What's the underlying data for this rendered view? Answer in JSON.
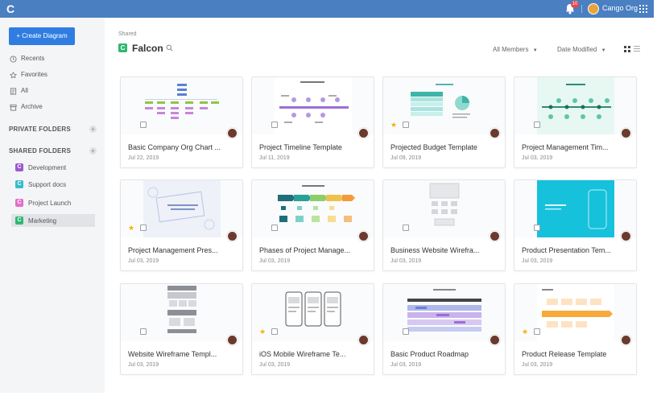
{
  "topbar": {
    "logo": "C",
    "notifications": "10",
    "org_name": "Cango Org"
  },
  "sidebar": {
    "create_label": "+ Create Diagram",
    "nav": [
      {
        "label": "Recents",
        "icon": "clock-icon"
      },
      {
        "label": "Favorites",
        "icon": "star-icon"
      },
      {
        "label": "All",
        "icon": "document-icon"
      },
      {
        "label": "Archive",
        "icon": "archive-icon"
      }
    ],
    "private_title": "PRIVATE FOLDERS",
    "shared_title": "SHARED FOLDERS",
    "folders": [
      {
        "label": "Development",
        "initial": "C",
        "color": "#9b59d0"
      },
      {
        "label": "Support docs",
        "initial": "C",
        "color": "#37bcc9"
      },
      {
        "label": "Project Launch",
        "initial": "C",
        "color": "#e66ec8"
      },
      {
        "label": "Marketing",
        "initial": "C",
        "color": "#2fb870"
      }
    ]
  },
  "main": {
    "breadcrumb": "Shared",
    "title": "Falcon",
    "title_initial": "C",
    "filter_members": "All Members",
    "filter_date": "Date Modified",
    "cards": [
      {
        "name": "Basic Company Org Chart ...",
        "date": "Jul 22, 2019",
        "starred": false
      },
      {
        "name": "Project Timeline Template",
        "date": "Jul 11, 2019",
        "starred": false
      },
      {
        "name": "Projected Budget Template",
        "date": "Jul 09, 2019",
        "starred": true
      },
      {
        "name": "Project Management Tim...",
        "date": "Jul 03, 2019",
        "starred": false
      },
      {
        "name": "Project Management Pres...",
        "date": "Jul 03, 2019",
        "starred": true
      },
      {
        "name": "Phases of Project Manage...",
        "date": "Jul 03, 2019",
        "starred": false
      },
      {
        "name": "Business Website Wirefra...",
        "date": "Jul 03, 2019",
        "starred": false
      },
      {
        "name": "Product Presentation Tem...",
        "date": "Jul 03, 2019",
        "starred": false
      },
      {
        "name": "Website Wireframe Templ...",
        "date": "Jul 03, 2019",
        "starred": false
      },
      {
        "name": "iOS Mobile Wireframe Te...",
        "date": "Jul 03, 2019",
        "starred": true
      },
      {
        "name": "Basic Product Roadmap",
        "date": "Jul 03, 2019",
        "starred": false
      },
      {
        "name": "Product Release Template",
        "date": "Jul 03, 2019",
        "starred": true
      }
    ]
  },
  "colors": {
    "topbar": "#4a7fc1",
    "create_button": "#2f7de1",
    "star": "#f0b400",
    "sidebar_bg": "#f4f5f7"
  }
}
